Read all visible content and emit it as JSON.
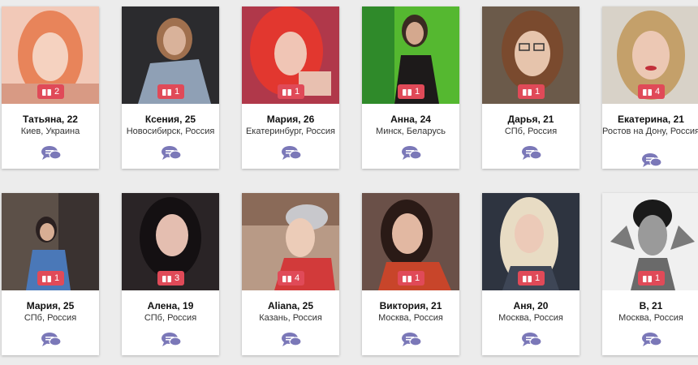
{
  "colors": {
    "badge": "#e04a58",
    "chat_icon": "#7b78b8",
    "page_bg": "#ececec"
  },
  "icons": {
    "badge": "gift-icon",
    "message": "chat-bubbles-icon"
  },
  "profiles": [
    {
      "name": "Татьяна, 22",
      "location": "Киев, Украина",
      "count": "2"
    },
    {
      "name": "Ксения, 25",
      "location": "Новосибирск, Россия",
      "count": "1"
    },
    {
      "name": "Мария, 26",
      "location": "Екатеринбург, Россия",
      "count": "1"
    },
    {
      "name": "Анна, 24",
      "location": "Минск, Беларусь",
      "count": "1"
    },
    {
      "name": "Дарья, 21",
      "location": "СПб, Россия",
      "count": "1"
    },
    {
      "name": "Екатерина, 21",
      "location": "Ростов на Дону, Россия",
      "count": "4"
    },
    {
      "name": "Мария, 25",
      "location": "СПб, Россия",
      "count": "1"
    },
    {
      "name": "Алена, 19",
      "location": "СПб, Россия",
      "count": "3"
    },
    {
      "name": "Aliana, 25",
      "location": "Казань, Россия",
      "count": "4"
    },
    {
      "name": "Виктория, 21",
      "location": "Москва, Россия",
      "count": "1"
    },
    {
      "name": "Аня, 20",
      "location": "Москва, Россия",
      "count": "1"
    },
    {
      "name": "В, 21",
      "location": "Москва, Россия",
      "count": "1"
    }
  ]
}
